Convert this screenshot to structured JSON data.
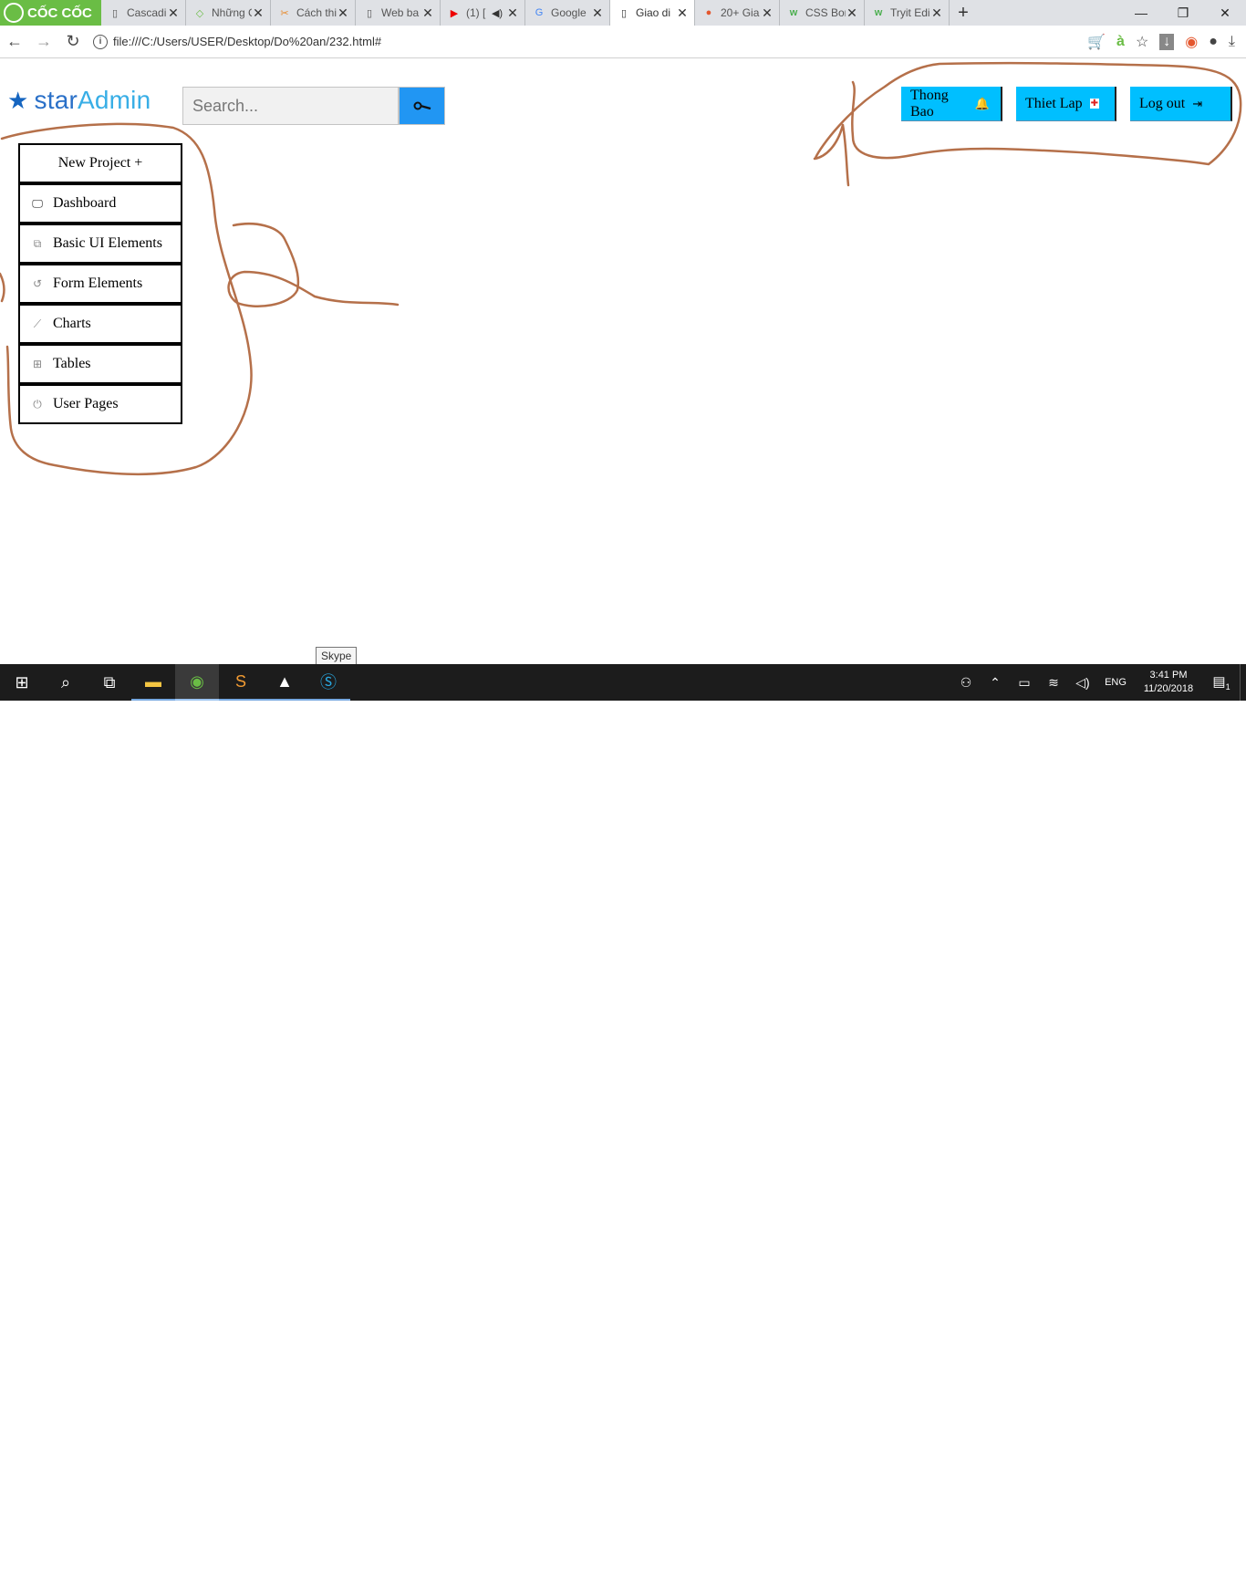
{
  "browser": {
    "brand": "CỐC CỐC",
    "tabs": [
      {
        "title": "Cascadi",
        "active": false
      },
      {
        "title": "Những C",
        "active": false
      },
      {
        "title": "Cách thi",
        "active": false
      },
      {
        "title": "Web ba",
        "active": false
      },
      {
        "title": "(1) [",
        "active": false
      },
      {
        "title": "Google",
        "active": false
      },
      {
        "title": "Giao di",
        "active": true
      },
      {
        "title": "20+ Gia",
        "active": false
      },
      {
        "title": "CSS Bor",
        "active": false
      },
      {
        "title": "Tryit Edi",
        "active": false
      }
    ],
    "new_tab": "+",
    "url": "file:///C:/Users/USER/Desktop/Do%20an/232.html#",
    "addr_extra": "à"
  },
  "page": {
    "logo": {
      "part1": "star",
      "part2": "Admin"
    },
    "search": {
      "placeholder": "Search..."
    },
    "sidebar": {
      "items": [
        {
          "label": "New Project +",
          "icon": ""
        },
        {
          "label": "Dashboard",
          "icon": "monitor-icon"
        },
        {
          "label": "Basic UI Elements",
          "icon": "copy-icon"
        },
        {
          "label": "Form Elements",
          "icon": "history-icon"
        },
        {
          "label": "Charts",
          "icon": "chart-icon"
        },
        {
          "label": "Tables",
          "icon": "table-icon"
        },
        {
          "label": "User Pages",
          "icon": "power-icon"
        }
      ]
    },
    "top_buttons": [
      {
        "label": "Thong Bao",
        "icon": "bell-icon"
      },
      {
        "label": "Thiet Lap",
        "icon": "settings-icon"
      },
      {
        "label": "Log out",
        "icon": "logout-icon"
      }
    ],
    "tooltip": "Skype"
  },
  "taskbar": {
    "lang": "ENG",
    "time": "3:41 PM",
    "date": "11/20/2018",
    "notification_count": "1"
  },
  "colors": {
    "button_bg": "#00bfff",
    "search_button": "#2196f3",
    "annotation_ink": "#b5704a",
    "brand_green": "#6abd45"
  }
}
